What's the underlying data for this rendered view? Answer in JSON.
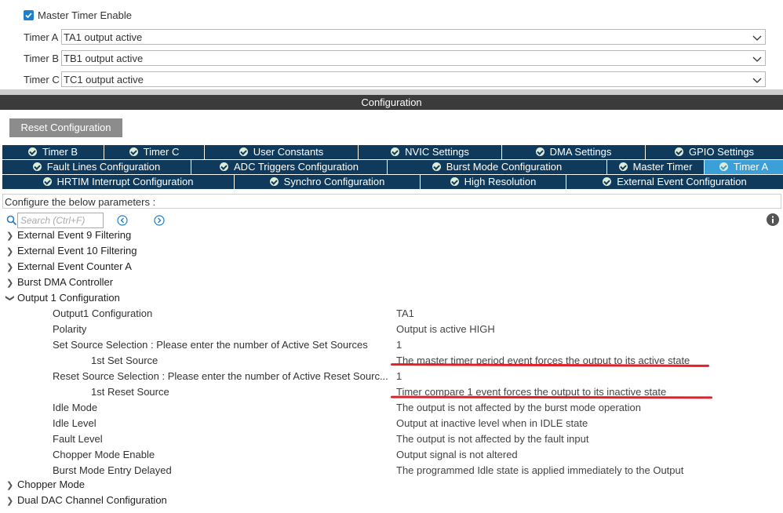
{
  "master": {
    "enable_label": "Master Timer Enable",
    "enabled": true,
    "selects": [
      {
        "label": "Timer A",
        "value": "TA1 output active"
      },
      {
        "label": "Timer B",
        "value": "TB1 output active"
      },
      {
        "label": "Timer C",
        "value": "TC1 output active"
      }
    ]
  },
  "config": {
    "bar_title": "Configuration",
    "reset_label": "Reset Configuration"
  },
  "tabs": {
    "row1": [
      "Timer B",
      "Timer C",
      "User Constants",
      "NVIC Settings",
      "DMA Settings",
      "GPIO Settings"
    ],
    "row2": [
      "Fault Lines Configuration",
      "ADC Triggers Configuration",
      "Burst Mode Configuration",
      "Master Timer",
      "Timer A"
    ],
    "row3": [
      "HRTIM Interrupt Configuration",
      "Synchro Configuration",
      "High Resolution",
      "External Event Configuration"
    ],
    "active": "Timer A"
  },
  "params": {
    "header": "Configure the below parameters :",
    "search_placeholder": "Search (Ctrl+F)",
    "tree": [
      "External Event 9 Filtering",
      "External Event 10 Filtering",
      "External Event Counter A",
      "Burst DMA Controller",
      "Output 1 Configuration"
    ],
    "rows": [
      {
        "label": "Output1 Configuration",
        "value": "TA1"
      },
      {
        "label": "Polarity",
        "value": "Output is active HIGH"
      },
      {
        "label": "Set Source  Selection : Please enter the number of Active Set Sources",
        "value": "1"
      },
      {
        "label": "1st Set Source",
        "value": "The master timer period event forces the output to its active state"
      },
      {
        "label": "Reset Source  Selection : Please enter the number of Active Reset Sourc...",
        "value": "1"
      },
      {
        "label": "1st Reset Source",
        "value": "Timer compare 1 event forces the output to its inactive state"
      },
      {
        "label": "Idle Mode",
        "value": "The output is not affected by the burst mode operation"
      },
      {
        "label": "Idle Level",
        "value": "Output at inactive level when in IDLE state"
      },
      {
        "label": "Fault Level",
        "value": "The output is not affected by the fault input"
      },
      {
        "label": "Chopper Mode Enable",
        "value": "Output signal is not altered"
      },
      {
        "label": "Burst Mode Entry Delayed",
        "value": "The programmed Idle state is applied immediately to the Output"
      }
    ],
    "tree_after": [
      "Chopper Mode",
      "Dual DAC Channel Configuration"
    ]
  },
  "colors": {
    "tab_bg": "#0f3a5c",
    "tab_active": "#3ca0d8",
    "highlight_line": "#e3202a"
  }
}
